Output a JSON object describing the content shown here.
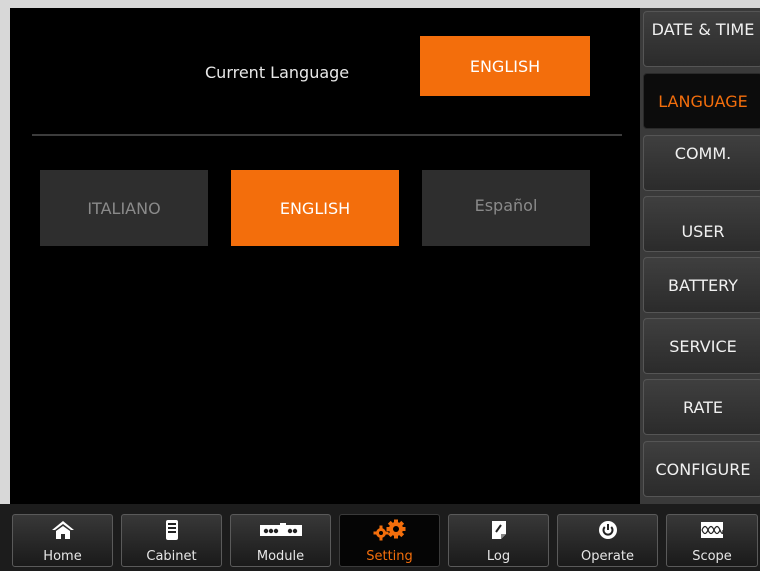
{
  "current_language": {
    "label": "Current Language",
    "value": "ENGLISH"
  },
  "languages": [
    {
      "label": "ITALIANO",
      "selected": false
    },
    {
      "label": "ENGLISH",
      "selected": true
    },
    {
      "label": "Español",
      "selected": false
    }
  ],
  "side_menu": [
    {
      "label": "DATE & TIME"
    },
    {
      "label": "LANGUAGE",
      "active": true
    },
    {
      "label": "COMM."
    },
    {
      "label": "USER"
    },
    {
      "label": "BATTERY"
    },
    {
      "label": "SERVICE"
    },
    {
      "label": "RATE"
    },
    {
      "label": "CONFIGURE"
    }
  ],
  "bottom_nav": [
    {
      "label": "Home",
      "icon": "home-icon"
    },
    {
      "label": "Cabinet",
      "icon": "cabinet-icon"
    },
    {
      "label": "Module",
      "icon": "module-icon"
    },
    {
      "label": "Setting",
      "icon": "gears-icon",
      "active": true
    },
    {
      "label": "Log",
      "icon": "log-icon"
    },
    {
      "label": "Operate",
      "icon": "power-icon"
    },
    {
      "label": "Scope",
      "icon": "scope-icon"
    }
  ],
  "colors": {
    "accent": "#f36e0c",
    "background": "#000000",
    "panel": "#3a3a3a"
  }
}
